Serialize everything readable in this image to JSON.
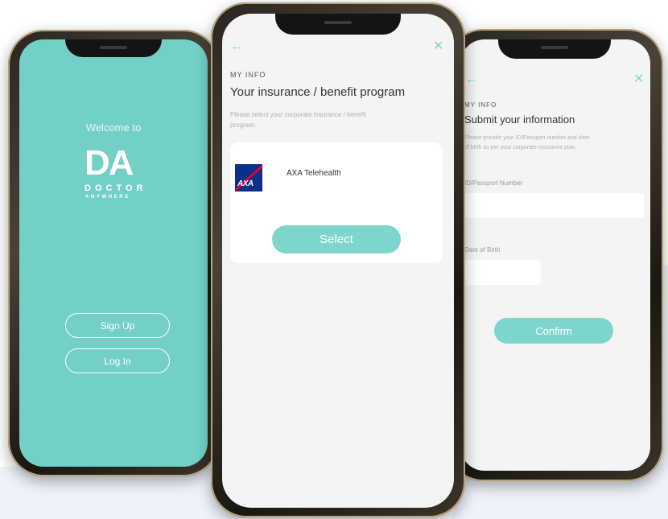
{
  "welcome_screen": {
    "welcome_text": "Welcome to",
    "logo_letters": "DA",
    "logo_line1": "DOCTOR",
    "logo_line2": "ANYWHERE",
    "signup_label": "Sign Up",
    "login_label": "Log In",
    "bg_color": "#72d0c6"
  },
  "insurance_screen": {
    "back_icon": "arrow-left-icon",
    "close_icon": "close-icon",
    "section_label": "MY INFO",
    "title": "Your insurance / benefit program",
    "description_line1": "Please select your corporate insurance / benefit",
    "description_line2": "program.",
    "option_name": "AXA Telehealth",
    "option_logo_text": "AXA",
    "select_label": "Select",
    "accent_color": "#7dd6cc"
  },
  "submit_screen": {
    "back_icon": "arrow-left-icon",
    "close_icon": "close-icon",
    "section_label": "MY INFO",
    "title": "Submit your information",
    "description_line1": "Please provide your ID/Passport number and date",
    "description_line2": "of birth as per your corporate insurance plan.",
    "id_label": "ID/Passport Number",
    "id_value": "",
    "dob_label": "Date of Birth",
    "dob_value": "",
    "confirm_label": "Confirm"
  }
}
